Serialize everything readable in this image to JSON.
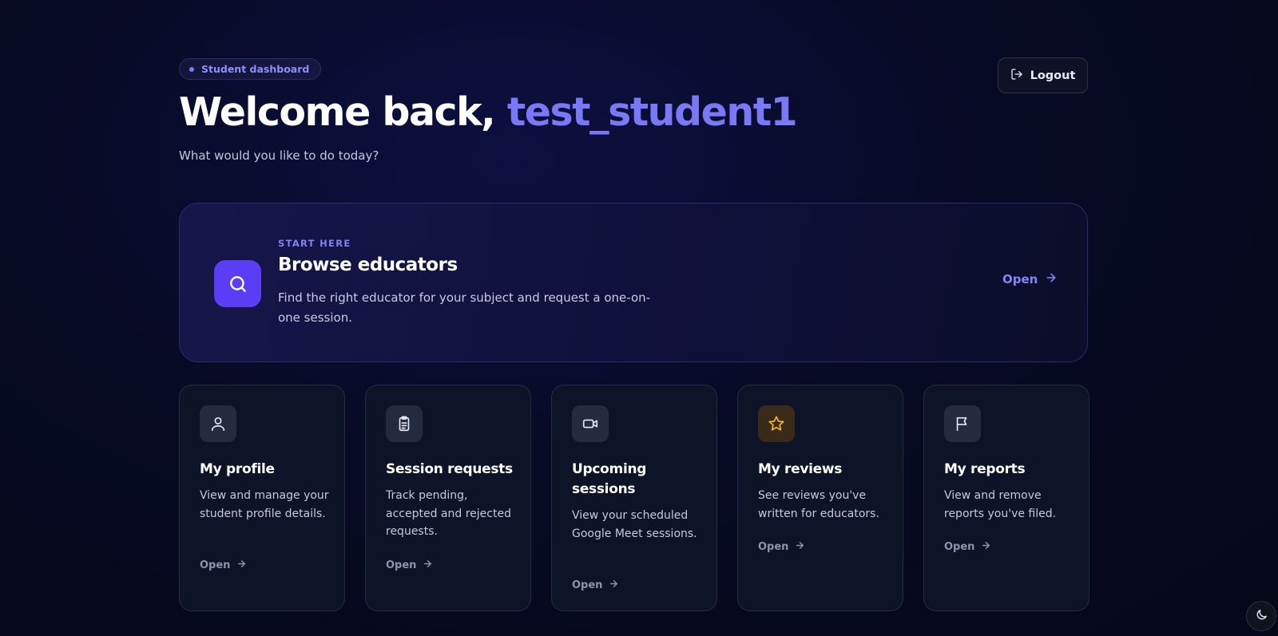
{
  "header": {
    "badge": "Student dashboard",
    "logout_label": "Logout",
    "welcome_prefix": "Welcome back, ",
    "username": "test_student1",
    "subtitle": "What would you like to do today?"
  },
  "hero": {
    "kicker": "START HERE",
    "title": "Browse educators",
    "description": "Find the right educator for your subject and request a one-on-one session.",
    "open_label": "Open",
    "icon": "search-icon"
  },
  "cards": [
    {
      "title": "My profile",
      "description": "View and manage your student profile details.",
      "open_label": "Open",
      "icon": "user-icon"
    },
    {
      "title": "Session requests",
      "description": "Track pending, accepted and rejected requests.",
      "open_label": "Open",
      "icon": "clipboard-icon"
    },
    {
      "title": "Upcoming sessions",
      "description": "View your scheduled Google Meet sessions.",
      "open_label": "Open",
      "icon": "video-icon"
    },
    {
      "title": "My reviews",
      "description": "See reviews you've written for educators.",
      "open_label": "Open",
      "icon": "star-icon"
    },
    {
      "title": "My reports",
      "description": "View and remove reports you've filed.",
      "open_label": "Open",
      "icon": "flag-icon"
    }
  ],
  "colors": {
    "accent": "#7a79f5",
    "hero_icon_bg": "#5b3df5",
    "star": "#f5b323",
    "background": "#070a24"
  },
  "theme_toggle_icon": "moon-icon"
}
